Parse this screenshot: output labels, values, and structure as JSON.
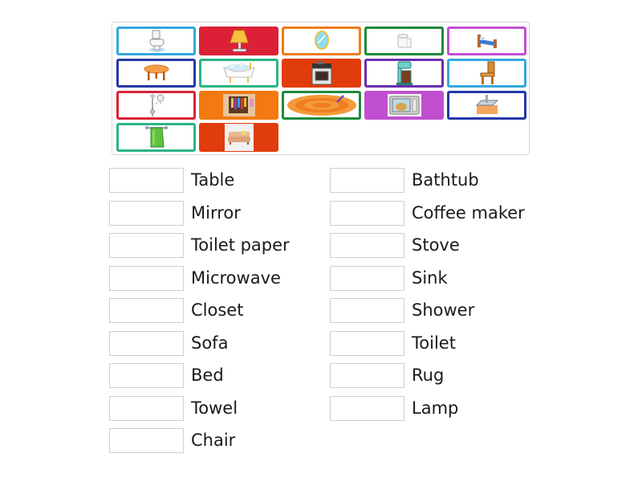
{
  "activity": {
    "type": "match-up",
    "cards": [
      {
        "icon": "toilet-icon",
        "style": "outlined",
        "color": "#35a7dc"
      },
      {
        "icon": "lamp-icon",
        "style": "filled",
        "color": "#dc2137"
      },
      {
        "icon": "mirror-icon",
        "style": "outlined",
        "color": "#ef7b1a"
      },
      {
        "icon": "toilet-paper-icon",
        "style": "outlined",
        "color": "#1d8a3d"
      },
      {
        "icon": "bed-icon",
        "style": "outlined",
        "color": "#c04fd0"
      },
      {
        "icon": "table-icon",
        "style": "outlined",
        "color": "#2538a8"
      },
      {
        "icon": "bathtub-icon",
        "style": "outlined",
        "color": "#2bb584"
      },
      {
        "icon": "stove-icon",
        "style": "filled",
        "color": "#e03c0c"
      },
      {
        "icon": "coffee-maker-icon",
        "style": "outlined",
        "color": "#6a2fb0"
      },
      {
        "icon": "chair-icon",
        "style": "outlined",
        "color": "#35a7dc"
      },
      {
        "icon": "shower-icon",
        "style": "outlined",
        "color": "#dc2137"
      },
      {
        "icon": "closet-icon",
        "style": "filled",
        "color": "#f27a10"
      },
      {
        "icon": "rug-icon",
        "style": "outlined",
        "color": "#1d8a3d"
      },
      {
        "icon": "microwave-icon",
        "style": "filled",
        "color": "#c04fd0"
      },
      {
        "icon": "sink-icon",
        "style": "outlined",
        "color": "#2538a8"
      },
      {
        "icon": "towel-icon",
        "style": "outlined",
        "color": "#2bb584"
      },
      {
        "icon": "sofa-icon",
        "style": "filled",
        "color": "#e03c0c"
      }
    ],
    "left_words": [
      "Table",
      "Mirror",
      "Toilet paper",
      "Microwave",
      "Closet",
      "Sofa",
      "Bed",
      "Towel",
      "Chair"
    ],
    "right_words": [
      "Bathtub",
      "Coffee maker",
      "Stove",
      "Sink",
      "Shower",
      "Toilet",
      "Rug",
      "Lamp"
    ]
  }
}
